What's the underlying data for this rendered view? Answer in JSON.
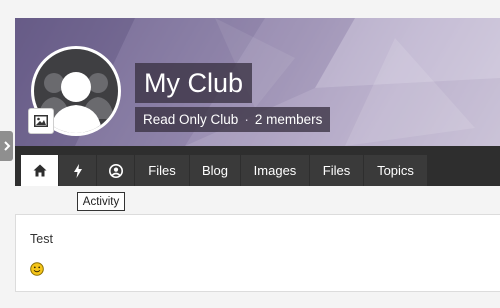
{
  "club": {
    "name": "My Club",
    "type": "Read Only Club",
    "separator": "·",
    "members": "2 members"
  },
  "tabs": [
    {
      "label": "",
      "icon": "home-icon",
      "active": true
    },
    {
      "label": "",
      "icon": "bolt-icon",
      "active": false
    },
    {
      "label": "",
      "icon": "user-circle-icon",
      "active": false
    },
    {
      "label": "Files",
      "active": false
    },
    {
      "label": "Blog",
      "active": false
    },
    {
      "label": "Images",
      "active": false
    },
    {
      "label": "Files",
      "active": false
    },
    {
      "label": "Topics",
      "active": false
    }
  ],
  "tooltip": {
    "text": "Activity"
  },
  "post": {
    "text": "Test",
    "emoji": "smiley-face-icon"
  },
  "colors": {
    "navbar": "#2e2e2e",
    "tab": "#3a3a3a",
    "active_tab": "#ffffff",
    "cover_start": "#6f6390",
    "cover_end": "#d8d2e2",
    "title_box": "#3a3242"
  }
}
